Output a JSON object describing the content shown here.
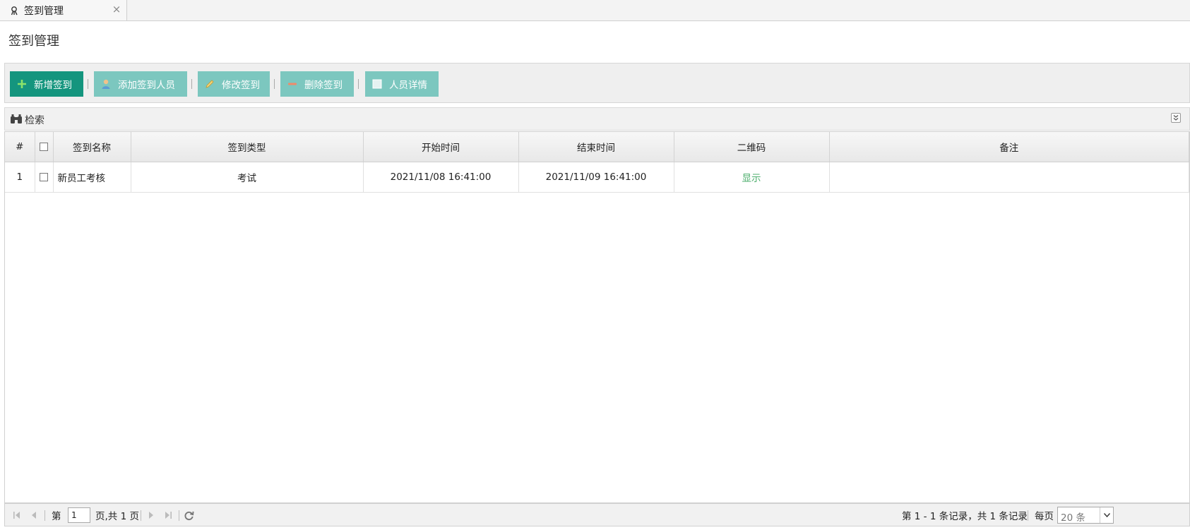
{
  "tab": {
    "label": "签到管理",
    "close": "×"
  },
  "page": {
    "title": "签到管理"
  },
  "toolbar": {
    "buttons": [
      {
        "label": "新增签到",
        "icon": "plus-icon",
        "style": "primary"
      },
      {
        "label": "添加签到人员",
        "icon": "user-icon",
        "style": "light"
      },
      {
        "label": "修改签到",
        "icon": "pencil-icon",
        "style": "light"
      },
      {
        "label": "删除签到",
        "icon": "minus-icon",
        "style": "light"
      },
      {
        "label": "人员详情",
        "icon": "detail-icon",
        "style": "light"
      }
    ]
  },
  "search": {
    "label": "检索",
    "icon": "binoculars-icon"
  },
  "table": {
    "columns": [
      "#",
      "",
      "签到名称",
      "签到类型",
      "开始时间",
      "结束时间",
      "二维码",
      "备注"
    ],
    "rows": [
      {
        "index": "1",
        "name": "新员工考核",
        "type": "考试",
        "start": "2021/11/08 16:41:00",
        "end": "2021/11/09 16:41:00",
        "qrcode": "显示",
        "remark": ""
      }
    ]
  },
  "pager": {
    "page_prefix": "第",
    "page_value": "1",
    "page_suffix": "页,共 1 页",
    "summary": "第 1 - 1 条记录，共 1 条记录",
    "per_page_label": "每页",
    "per_page_value": "20 条"
  },
  "colors": {
    "primary": "#14957e",
    "light": "#7cc7bf",
    "link": "#4cae6c"
  }
}
